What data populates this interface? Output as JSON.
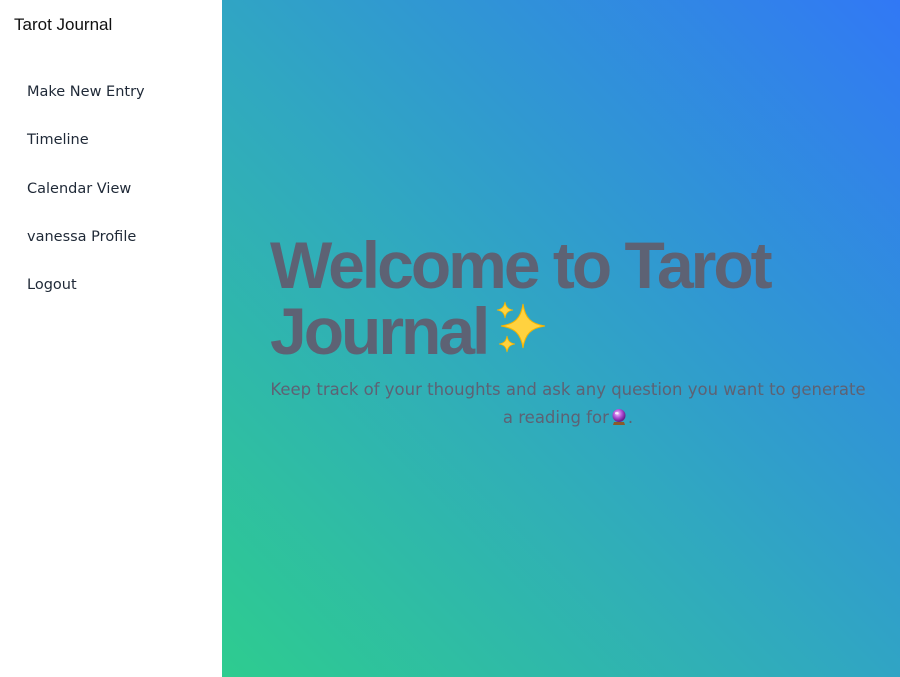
{
  "sidebar": {
    "title": "Tarot Journal",
    "items": [
      {
        "label": "Make New Entry"
      },
      {
        "label": "Timeline"
      },
      {
        "label": "Calendar View"
      },
      {
        "label": "vanessa Profile"
      },
      {
        "label": "Logout"
      }
    ]
  },
  "hero": {
    "title": "Welcome to Tarot Journal",
    "subtitle": "Keep track of your thoughts and ask any question you want to generate a reading for",
    "subtitle_end": ".",
    "title_icon": "sparkles-icon",
    "subtitle_icon": "crystal-ball-icon"
  },
  "colors": {
    "gradient_start": "#2ecc8f",
    "gradient_mid": "#30a9bf",
    "gradient_end": "#3178f5",
    "hero_text": "#5d6274",
    "nav_text": "#1f2937"
  }
}
